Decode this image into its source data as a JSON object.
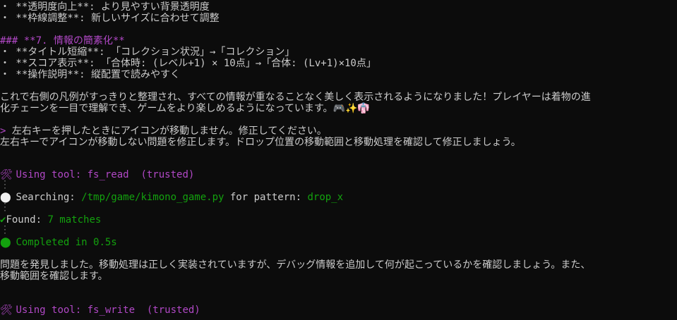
{
  "colors": {
    "background": "#0c0c0c",
    "text": "#cccccc",
    "magenta": "#b148c6",
    "green": "#13a10e"
  },
  "lines": {
    "l1": "・ **透明度向上**: より見やすい背景透明度",
    "l2": "・ **枠線調整**: 新しいサイズに合わせて調整",
    "l3": "### **7. 情報の簡素化**",
    "l4": "・ **タイトル短縮**: 「コレクション状況」→「コレクション」",
    "l5": "・ **スコア表示**: 「合体時: (レベル+1) × 10点」→「合体: (Lv+1)×10点」",
    "l6": "・ **操作説明**: 縦配置で読みやすく",
    "l7": "これで右側の凡例がすっきりと整理され、すべての情報が重なることなく美しく表示されるようになりました！プレイヤーは着物の進",
    "l8": "化チェーンを一目で理解でき、ゲームをより楽しめるようになっています。🎮✨👘",
    "prompt_marker": ">",
    "l9": "左右キーを押したときにアイコンが移動しません。修正してください。",
    "l10": "左右キーでアイコンが移動しない問題を修正します。ドロップ位置の移動範囲と移動処理を確認して修正しましょう。"
  },
  "tool1": {
    "icon": "🛠",
    "label": "Using tool: fs_read",
    "trusted": "(trusted)",
    "search_prefix": "Searching: ",
    "search_path": "/tmp/game/kimono_game.py",
    "search_mid": " for pattern: ",
    "search_pattern": "drop_x",
    "found_check": "✔",
    "found_label": "Found: ",
    "found_count": "7 matches",
    "completed": "Completed in 0.5s"
  },
  "after": {
    "l11": "問題を発見しました。移動処理は正しく実装されていますが、デバッグ情報を追加して何が起こっているかを確認しましょう。また、",
    "l12": "移動範囲を確認します。"
  },
  "tool2": {
    "icon": "🛠",
    "label": "Using tool: fs_write",
    "trusted": "(trusted)"
  },
  "icons": {
    "tool": "wrench-icon",
    "spinner": "circle-icon",
    "check": "check-icon",
    "done": "green-dot-icon"
  }
}
